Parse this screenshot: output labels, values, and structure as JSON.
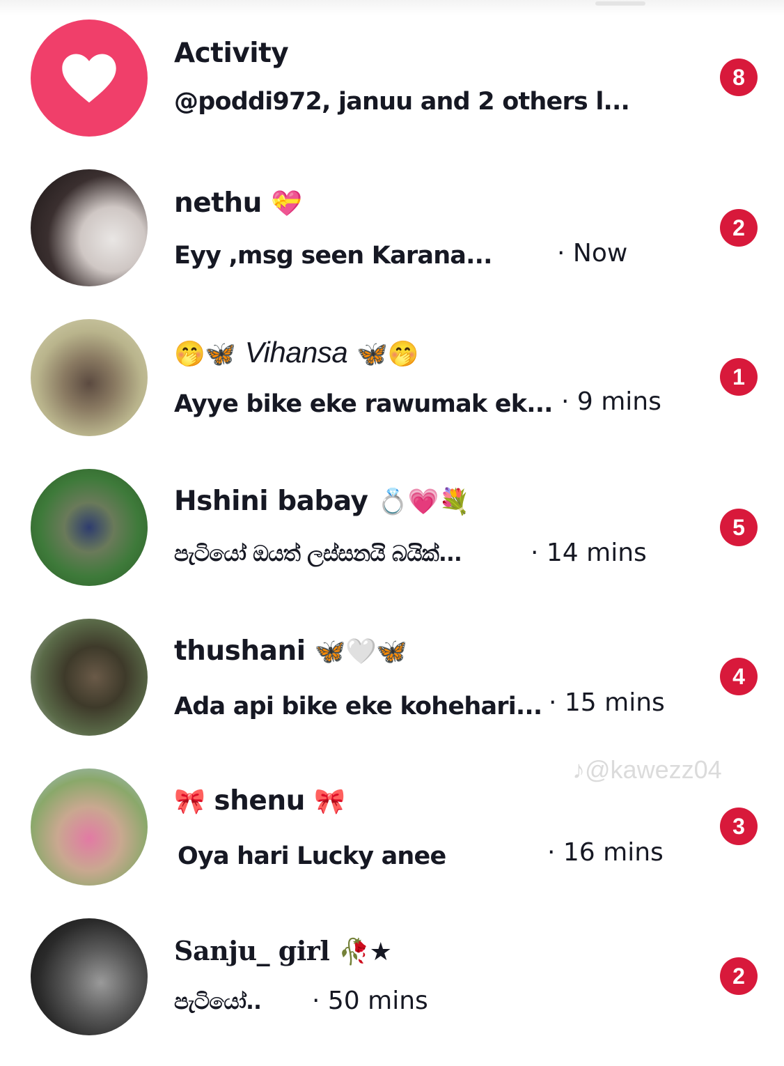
{
  "colors": {
    "badge": "#d8193b",
    "activity_icon_bg": "#f03f6a",
    "text": "#161823"
  },
  "activity": {
    "title": "Activity",
    "preview": "@poddi972, januu and 2 others l...",
    "badge": "8",
    "icon": "heart-icon"
  },
  "conversations": [
    {
      "name": "nethu",
      "name_prefix_emoji": "",
      "name_suffix_emoji": "💝",
      "preview": "Eyy ,msg seen Karana...",
      "time": "· Now",
      "badge": "2"
    },
    {
      "name": "Vihansa",
      "name_prefix_emoji": "🤭🦋",
      "name_suffix_emoji": "🦋🤭",
      "preview": "Ayye bike eke rawumak ek...",
      "time": "· 9 mins",
      "badge": "1"
    },
    {
      "name": "Hshini babay",
      "name_prefix_emoji": "",
      "name_suffix_emoji": "💍💗💐",
      "preview": "පැටියෝ ඔයත් ලස්සනයි බයික්...",
      "time": "· 14 mins",
      "badge": "5"
    },
    {
      "name": "thushani",
      "name_prefix_emoji": "",
      "name_suffix_emoji": "🦋🤍🦋",
      "preview": "Ada api bike eke kohehari...",
      "time": "· 15 mins",
      "badge": "4"
    },
    {
      "name": "shenu",
      "name_prefix_emoji": "🎀",
      "name_suffix_emoji": "🎀",
      "preview": "Oya hari Lucky anee",
      "time": "· 16 mins",
      "badge": "3"
    },
    {
      "name": "Sanju_ girl",
      "name_prefix_emoji": "",
      "name_suffix_emoji": "🥀★",
      "preview": "පැටියෝ..",
      "time": "· 50 mins",
      "badge": "2"
    }
  ],
  "watermark": "♪@kawezz04"
}
